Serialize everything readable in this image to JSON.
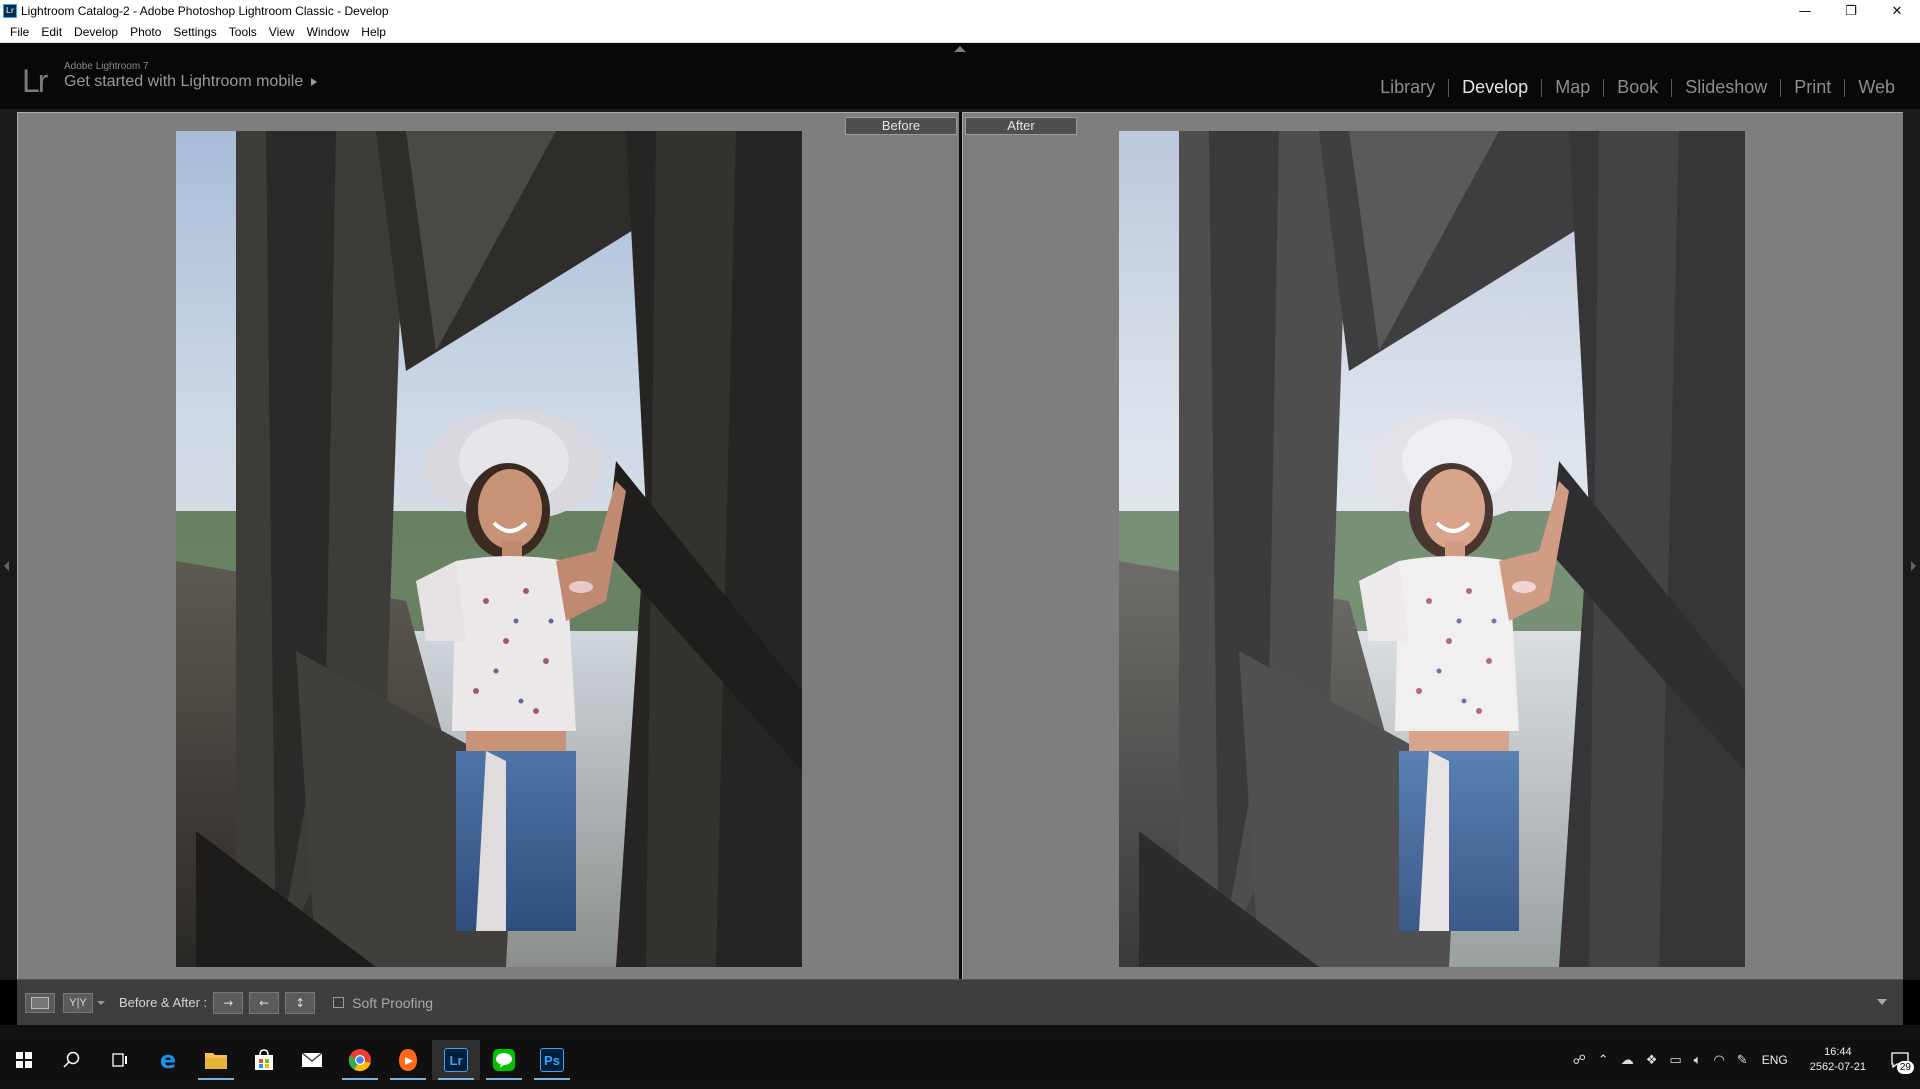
{
  "window": {
    "title": "Lightroom Catalog-2 - Adobe Photoshop Lightroom Classic - Develop",
    "app_icon": "Lr",
    "controls": {
      "minimize": "—",
      "restore": "❐",
      "close": "✕"
    }
  },
  "menu": [
    "File",
    "Edit",
    "Develop",
    "Photo",
    "Settings",
    "Tools",
    "View",
    "Window",
    "Help"
  ],
  "identity_plate": {
    "logo": "Lr",
    "version": "Adobe Lightroom 7",
    "mobile_prompt": "Get started with Lightroom mobile"
  },
  "modules": [
    {
      "label": "Library",
      "active": false
    },
    {
      "label": "Develop",
      "active": true
    },
    {
      "label": "Map",
      "active": false
    },
    {
      "label": "Book",
      "active": false
    },
    {
      "label": "Slideshow",
      "active": false
    },
    {
      "label": "Print",
      "active": false
    },
    {
      "label": "Web",
      "active": false
    }
  ],
  "view": {
    "before_label": "Before",
    "after_label": "After"
  },
  "toolbar": {
    "view_mode_label": "Y|Y",
    "before_after_label": "Before & After :",
    "copy_before_to_after": "→",
    "copy_after_to_before": "←",
    "swap": "↕",
    "soft_proofing_label": "Soft Proofing",
    "soft_proofing_checked": false
  },
  "taskbar": {
    "apps": [
      {
        "name": "edge",
        "glyph": "e",
        "color": "#1e90e8"
      },
      {
        "name": "file-explorer",
        "glyph": "",
        "color": "#f2c14e"
      },
      {
        "name": "store",
        "glyph": "",
        "color": "#ffffff"
      },
      {
        "name": "mail",
        "glyph": "",
        "color": "#ffffff"
      },
      {
        "name": "chrome",
        "glyph": "",
        "color": "#e94235"
      },
      {
        "name": "media-player",
        "glyph": "",
        "color": "#ff6a1a"
      },
      {
        "name": "lightroom",
        "glyph": "Lr",
        "color": "#31a8ff"
      },
      {
        "name": "line",
        "glyph": "",
        "color": "#00c300"
      },
      {
        "name": "photoshop",
        "glyph": "Ps",
        "color": "#31a8ff"
      }
    ],
    "language": "ENG",
    "time": "16:44",
    "date": "2562-07-21",
    "notification_count": "29"
  }
}
